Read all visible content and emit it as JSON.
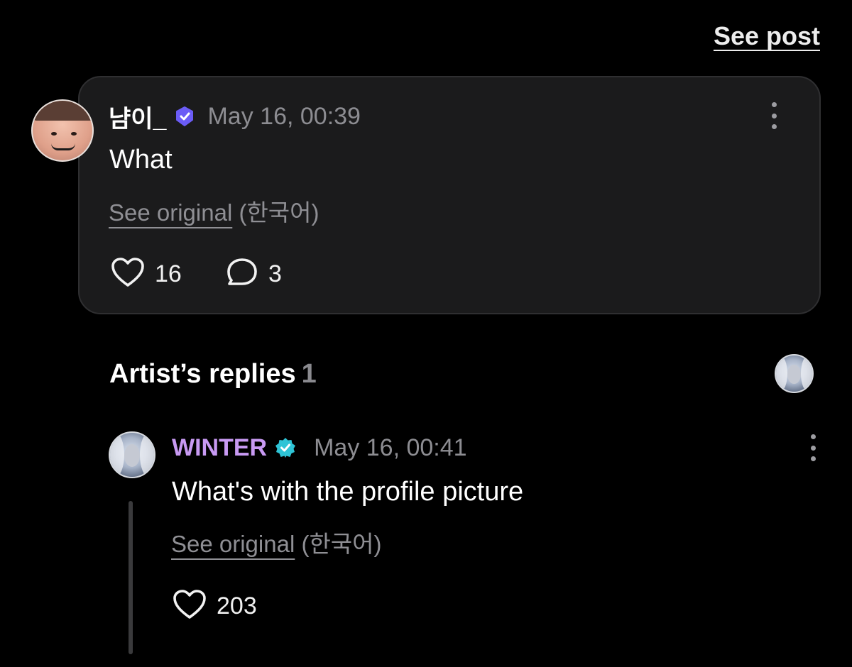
{
  "header": {
    "see_post_label": "See post"
  },
  "comment": {
    "username": "냠이_",
    "timestamp": "May 16, 00:39",
    "text": "What",
    "see_original_label": "See original",
    "language": "(한국어)",
    "likes": "16",
    "replies": "3"
  },
  "artist_replies": {
    "title": "Artist’s replies",
    "count": "1"
  },
  "reply": {
    "username": "WINTER",
    "timestamp": "May 16, 00:41",
    "text": "What's with the profile picture",
    "see_original_label": "See original",
    "language": "(한국어)",
    "likes": "203"
  },
  "colors": {
    "background": "#000000",
    "card": "#1b1b1c",
    "artist_name": "#c89af3",
    "verified_fan_badge": "#6b5cf6",
    "verified_artist_badge": "#2ec4d6",
    "muted_text": "#8d8d92"
  },
  "icons": {
    "verified_user": "shield-check-icon",
    "verified_artist": "verified-badge-icon",
    "like": "heart-outline-icon",
    "reply": "speech-bubble-icon",
    "more": "vertical-dots-icon"
  }
}
